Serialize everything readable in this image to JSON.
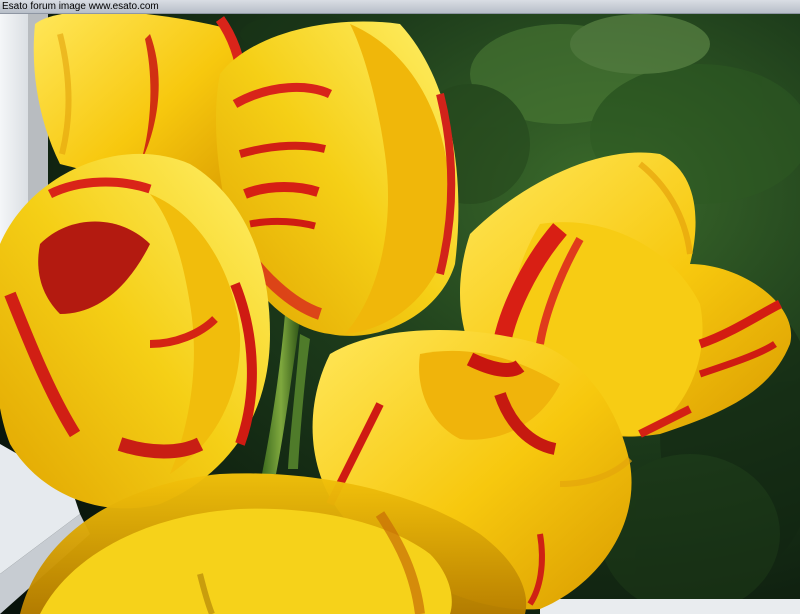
{
  "banner": {
    "text": "Esato forum image www.esato.com"
  },
  "photo": {
    "subject": "tulips",
    "colors": {
      "petal_yellow": "#f7d312",
      "petal_deep_yellow": "#e8b000",
      "stripe_red": "#d41e12",
      "foliage_dark": "#10220f",
      "foliage_mid": "#2f5a24",
      "window_frame": "#e9ecef"
    }
  }
}
